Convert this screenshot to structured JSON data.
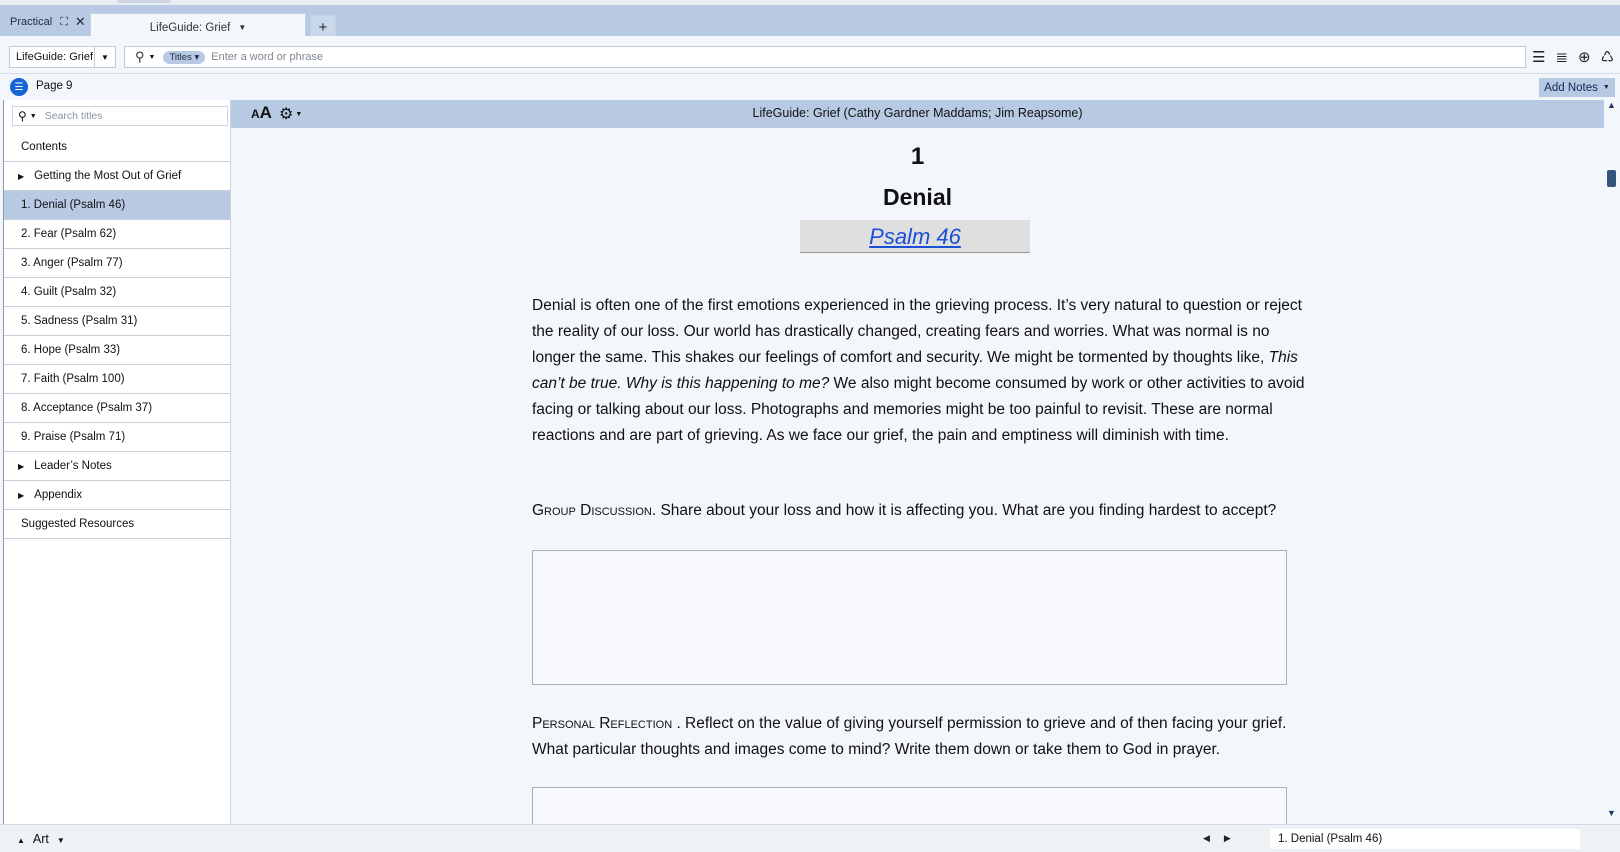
{
  "tabs": {
    "workspace_label": "Practical",
    "book_tab_label": "LifeGuide: Grief",
    "new_tab": "+"
  },
  "toolbar": {
    "book_select": "LifeGuide: Grief",
    "search_scope": "Titles",
    "search_placeholder": "Enter a word or phrase"
  },
  "page_row": {
    "page_label": "Page 9",
    "add_notes": "Add Notes"
  },
  "sidebar": {
    "search_placeholder": "Search titles",
    "items": [
      {
        "label": "Contents"
      },
      {
        "label": "Getting the Most Out of Grief"
      },
      {
        "label": "1. Denial (Psalm 46)"
      },
      {
        "label": "2. Fear (Psalm 62)"
      },
      {
        "label": "3. Anger (Psalm 77)"
      },
      {
        "label": "4. Guilt (Psalm 32)"
      },
      {
        "label": "5. Sadness (Psalm 31)"
      },
      {
        "label": "6. Hope (Psalm 33)"
      },
      {
        "label": "7. Faith (Psalm 100)"
      },
      {
        "label": "8. Acceptance (Psalm 37)"
      },
      {
        "label": "9. Praise (Psalm 71)"
      },
      {
        "label": "Leader’s Notes"
      },
      {
        "label": "Appendix"
      },
      {
        "label": "Suggested Resources"
      }
    ]
  },
  "reader": {
    "font_size_icon": "AA",
    "book_title": "LifeGuide: Grief (Cathy Gardner Maddams; Jim Reapsome)",
    "chapter_number": "1",
    "chapter_title": "Denial",
    "scripture_ref": "Psalm 46",
    "intro_part1": "Denial is often one of the first emotions experienced in the grieving process. It’s very natural to question or reject the reality of our loss. Our world has drastically changed, creating fears and worries. What was normal is no longer the same. This shakes our feelings of comfort and security. We might be tormented by thoughts like, ",
    "intro_italic": "This can’t be true. Why is this happening to me?",
    "intro_part2": " We also might become consumed by work or other activities to avoid facing or talking about our loss. Photographs and memories might be too painful to revisit. These are normal reactions and are part of grieving. As we face our grief, the pain and emptiness will diminish with time.",
    "group_label": "Group Discussion.",
    "group_text": " Share about your loss and how it is affecting you. What are you finding hardest to accept?",
    "personal_label": "Personal Reflection",
    "personal_text": " . Reflect on the value of giving yourself permission to grieve and of then facing your grief. What particular thoughts and images come to mind? Write them down or take them to God in prayer."
  },
  "statusbar": {
    "panel_label": "Art",
    "location": "1. Denial (Psalm 46)"
  },
  "colors": {
    "accent": "#b7c9e3",
    "link": "#1a4fd6",
    "page_icon": "#1565d8"
  }
}
